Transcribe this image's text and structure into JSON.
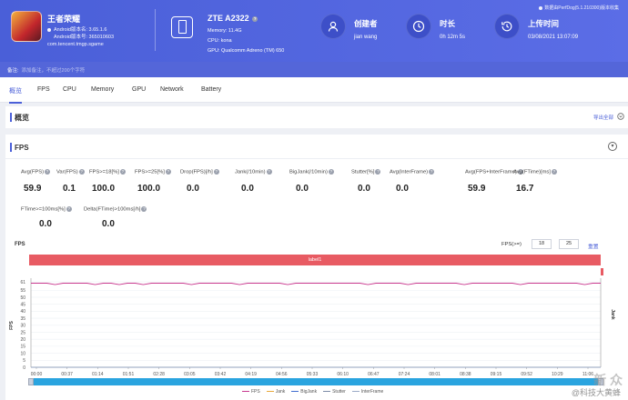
{
  "header": {
    "app": {
      "name": "王者荣耀",
      "android_version_name": "Android版本名: 3.65.1.6",
      "android_version_code": "Android版本号: 365010603",
      "package": "com.tencent.tmgp.sgame"
    },
    "device": {
      "name": "ZTE A2322",
      "memory": "Memory: 11.4G",
      "cpu": "CPU: kona",
      "gpu": "GPU: Qualcomm Adreno (TM) 650"
    },
    "creator": {
      "title": "创建者",
      "value": "jian wang"
    },
    "duration": {
      "title": "时长",
      "value": "0h 12m 5s"
    },
    "upload": {
      "title": "上传时间",
      "value": "03/08/2021 13:07:09"
    },
    "perfdog_note": "数据由PerfDog(5.1.210300)版本收集"
  },
  "note": {
    "label": "备注:",
    "placeholder": "添加备注，不超过200个字符"
  },
  "tabs": [
    "概览",
    "FPS",
    "CPU",
    "Memory",
    "GPU",
    "Network",
    "Battery"
  ],
  "overview": {
    "title": "概览",
    "export": "导出全部"
  },
  "fps_panel": {
    "title": "FPS",
    "metrics_row1": [
      {
        "label": "Avg(FPS)",
        "value": "59.9"
      },
      {
        "label": "Var(FPS)",
        "value": "0.1"
      },
      {
        "label": "FPS>=18[%]",
        "value": "100.0"
      },
      {
        "label": "FPS>=25[%]",
        "value": "100.0"
      },
      {
        "label": "Drop(FPS)[/h]",
        "value": "0.0"
      },
      {
        "label": "Jank(/10min)",
        "value": "0.0"
      },
      {
        "label": "BigJank(/10min)",
        "value": "0.0"
      },
      {
        "label": "Stutter[%]",
        "value": "0.0"
      },
      {
        "label": "Avg(InterFrame)",
        "value": "0.0"
      },
      {
        "label": "Avg(FPS+InterFrame)",
        "value": "59.9"
      },
      {
        "label": "Avg(FTime)[ms]",
        "value": "16.7"
      }
    ],
    "metrics_row2": [
      {
        "label": "FTime>=100ms[%]",
        "value": "0.0"
      },
      {
        "label": "Delta(FTime)>100ms[/h]",
        "value": "0.0"
      }
    ],
    "chart_title": "FPS",
    "fps_ge_label": "FPS(>=)",
    "fps_ge_values": [
      "18",
      "25"
    ],
    "reset": "重置",
    "label_bar": "label1"
  },
  "chart_data": {
    "type": "line",
    "ylabel": "FPS",
    "y2label": "Jank",
    "ylim": [
      0,
      61
    ],
    "yticks": [
      "61",
      "55",
      "50",
      "45",
      "40",
      "35",
      "30",
      "25",
      "20",
      "15",
      "10",
      "5",
      "0"
    ],
    "x_ticks": [
      "00:00",
      "00:37",
      "01:14",
      "01:51",
      "02:28",
      "03:05",
      "03:42",
      "04:19",
      "04:56",
      "05:33",
      "06:10",
      "06:47",
      "07:24",
      "08:01",
      "08:38",
      "09:15",
      "09:52",
      "10:29",
      "11:06"
    ],
    "series": [
      {
        "name": "FPS",
        "color": "#c8388e",
        "values": [
          60,
          60,
          60,
          59,
          60,
          60,
          60,
          60,
          59,
          60,
          60,
          59,
          60,
          60,
          59,
          60,
          60,
          60,
          60,
          60,
          59,
          60,
          60,
          60,
          60,
          60,
          59,
          60,
          60,
          60,
          60,
          60,
          59,
          60,
          60,
          60,
          60,
          60,
          60,
          60,
          60,
          60,
          59,
          60,
          60,
          60,
          60,
          59,
          60,
          60,
          60,
          60,
          60,
          60,
          59,
          60,
          60,
          60,
          60,
          60,
          60,
          59,
          60,
          60,
          60,
          60,
          60,
          60,
          60,
          59,
          60,
          60
        ]
      },
      {
        "name": "Jank",
        "color": "#e8a83a",
        "values": [
          0
        ]
      },
      {
        "name": "BigJank",
        "color": "#3f6ccf",
        "values": [
          0
        ]
      },
      {
        "name": "Stutter",
        "color": "#7b8ba6",
        "values": [
          0
        ]
      },
      {
        "name": "InterFrame",
        "color": "#9aa9c6",
        "values": [
          0
        ]
      }
    ],
    "legend": [
      "FPS",
      "Jank",
      "BigJank",
      "Stutter",
      "InterFrame"
    ]
  },
  "watermark": {
    "brand": "新 众",
    "handle": "@科技大黄蜂"
  }
}
